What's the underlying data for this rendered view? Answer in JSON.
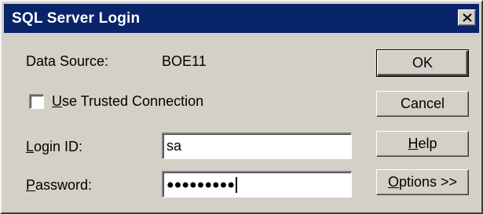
{
  "window": {
    "title": "SQL Server Login",
    "close_icon": "close-icon"
  },
  "form": {
    "data_source_label": "Data Source:",
    "data_source_value": "BOE11",
    "trusted_connection": {
      "label_accel": "U",
      "label_rest": "se Trusted Connection",
      "checked": false
    },
    "login_id": {
      "label_accel": "L",
      "label_rest": "ogin ID:",
      "value": "sa"
    },
    "password": {
      "label_accel": "P",
      "label_rest": "assword:",
      "masked_value": "●●●●●●●●●"
    }
  },
  "buttons": {
    "ok": "OK",
    "cancel": "Cancel",
    "help_accel": "H",
    "help_rest": "elp",
    "options_accel": "O",
    "options_rest": "ptions >>"
  }
}
